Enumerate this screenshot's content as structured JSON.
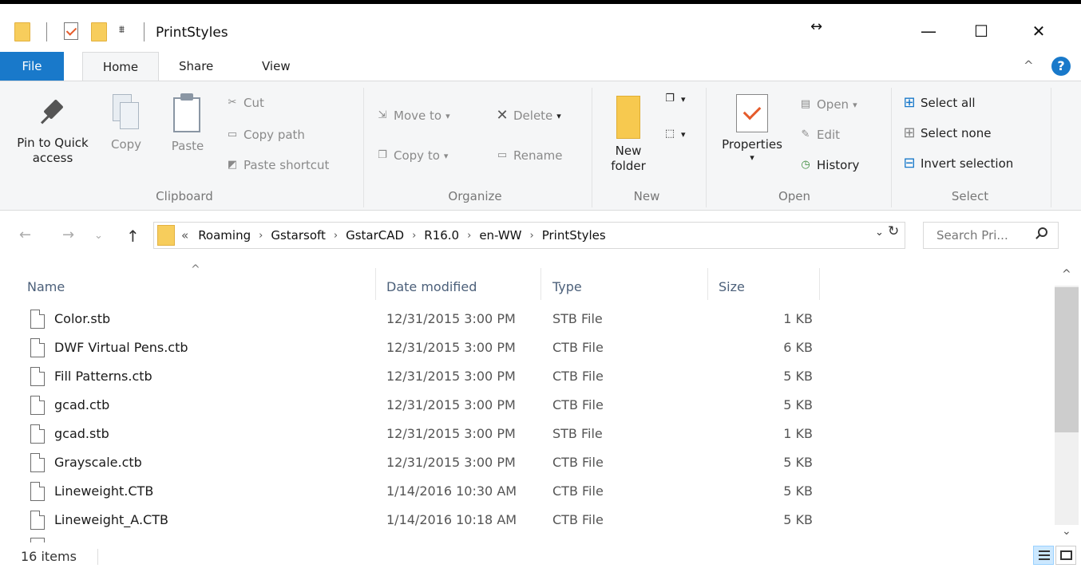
{
  "window": {
    "title": "PrintStyles",
    "resize_glyph": "↔",
    "minimize_glyph": "—",
    "maximize_glyph": "☐",
    "close_glyph": "✕"
  },
  "quick_access": {
    "dropdown_glyph": "⩩"
  },
  "tabs": {
    "file": "File",
    "home": "Home",
    "share": "Share",
    "view": "View",
    "collapse_glyph": "^",
    "help_glyph": "?"
  },
  "ribbon": {
    "clipboard": {
      "pin": "Pin to Quick access",
      "copy": "Copy",
      "paste": "Paste",
      "cut": "Cut",
      "copy_path": "Copy path",
      "paste_shortcut": "Paste shortcut",
      "label": "Clipboard"
    },
    "organize": {
      "move_to": "Move to",
      "copy_to": "Copy to",
      "delete": "Delete",
      "rename": "Rename",
      "label": "Organize"
    },
    "new": {
      "new_folder": "New folder",
      "label": "New"
    },
    "open": {
      "properties": "Properties",
      "open": "Open",
      "edit": "Edit",
      "history": "History",
      "label": "Open"
    },
    "select": {
      "select_all": "Select all",
      "select_none": "Select none",
      "invert": "Invert selection",
      "label": "Select"
    }
  },
  "nav": {
    "back_glyph": "←",
    "forward_glyph": "→",
    "recent_glyph": "⌄",
    "up_glyph": "↑",
    "overflow": "«",
    "breadcrumbs": [
      "Roaming",
      "Gstarsoft",
      "GstarCAD",
      "R16.0",
      "en-WW",
      "PrintStyles"
    ],
    "crumb_sep": "›",
    "dropdown_glyph": "⌄",
    "refresh_glyph": "↻",
    "search_placeholder": "Search Pri..."
  },
  "columns": {
    "name": "Name",
    "date": "Date modified",
    "type": "Type",
    "size": "Size",
    "sort_glyph": "^"
  },
  "files": [
    {
      "name": "Color.stb",
      "date": "12/31/2015 3:00 PM",
      "type": "STB File",
      "size": "1 KB"
    },
    {
      "name": "DWF Virtual Pens.ctb",
      "date": "12/31/2015 3:00 PM",
      "type": "CTB File",
      "size": "6 KB"
    },
    {
      "name": "Fill Patterns.ctb",
      "date": "12/31/2015 3:00 PM",
      "type": "CTB File",
      "size": "5 KB"
    },
    {
      "name": "gcad.ctb",
      "date": "12/31/2015 3:00 PM",
      "type": "CTB File",
      "size": "5 KB"
    },
    {
      "name": "gcad.stb",
      "date": "12/31/2015 3:00 PM",
      "type": "STB File",
      "size": "1 KB"
    },
    {
      "name": "Grayscale.ctb",
      "date": "12/31/2015 3:00 PM",
      "type": "CTB File",
      "size": "5 KB"
    },
    {
      "name": "Lineweight.CTB",
      "date": "1/14/2016 10:30 AM",
      "type": "CTB File",
      "size": "5 KB"
    },
    {
      "name": "Lineweight_A.CTB",
      "date": "1/14/2016 10:18 AM",
      "type": "CTB File",
      "size": "5 KB"
    }
  ],
  "scroll": {
    "up_glyph": "^",
    "down_glyph": "⌄"
  },
  "status": {
    "items": "16 items"
  },
  "colors": {
    "accent": "#1979ca",
    "folder": "#f7cd5c",
    "check": "#e55b2b",
    "ribbon_bg": "#f5f6f7"
  }
}
